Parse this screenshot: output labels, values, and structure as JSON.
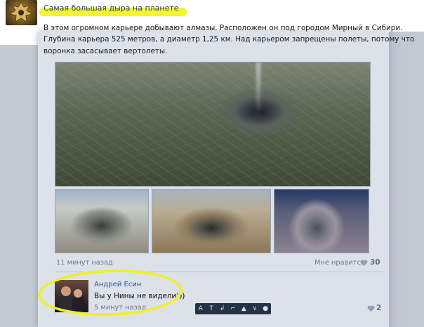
{
  "post": {
    "title": "Самая большая дыра на планете",
    "text_line1": "В этом огромном карьере добывают алмазы. Расположен он под городом Мирный в Сибири.",
    "text_line2": "Глубина карьера 525 метров, а диаметр 1,25 км. Над карьером запрещены полеты, потому что",
    "text_line3": "воронка засасывает вертолеты.",
    "time": "11 минут назад",
    "like_label": "Мне нравится",
    "like_count": "30",
    "photos": [
      {
        "alt": "aerial view of the mine near the town"
      },
      {
        "alt": "mine pit"
      },
      {
        "alt": "mine pit"
      },
      {
        "alt": "mine pit"
      }
    ]
  },
  "comment": {
    "author": "Андрей Есин",
    "text": "Вы у Нины не видели)))",
    "time": "5 минут назад",
    "like_count": "2"
  },
  "toolbar": {
    "items": [
      "A",
      "T",
      "↲",
      "⌐",
      "▲",
      "∨",
      "●"
    ]
  },
  "colors": {
    "link": "#2b5790",
    "meta": "#6a7a92",
    "highlight": "#f2f223",
    "card_bg": "#dde2ea"
  }
}
